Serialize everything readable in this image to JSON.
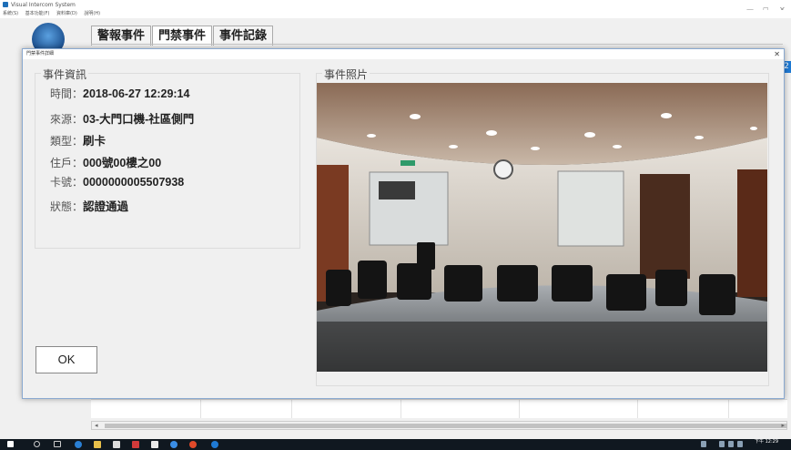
{
  "app": {
    "title": "Visual Intercom System",
    "menu": [
      "系統(S)",
      "基本功能(F)",
      "資料庫(D)",
      "說明(H)"
    ],
    "window_controls": [
      "—",
      "◻",
      "✕"
    ],
    "tabs": [
      {
        "label": "警報事件",
        "active": false
      },
      {
        "label": "門禁事件",
        "active": true
      },
      {
        "label": "事件記錄",
        "active": false
      }
    ],
    "side_badge": "2"
  },
  "dialog": {
    "title": "門禁事件詳細",
    "close_label": "✕",
    "info_group_title": "事件資訊",
    "photo_group_title": "事件照片",
    "fields": [
      {
        "label": "時間：",
        "value": "2018-06-27 12:29:14"
      },
      {
        "label": "來源：",
        "value": "03-大門口機-社區側門"
      },
      {
        "label": "類型：",
        "value": "刷卡"
      },
      {
        "label": "住戶：",
        "value": "000號00樓之00"
      },
      {
        "label": "卡號：",
        "value": "0000000005507938"
      },
      {
        "label": "狀態：",
        "value": "認證通過"
      }
    ],
    "ok_label": "OK"
  },
  "taskbar": {
    "icons": [
      "windows-icon",
      "search-icon",
      "task-view-icon",
      "edge-icon",
      "file-explorer-icon",
      "store-icon",
      "app-icon",
      "mail-icon",
      "ie-icon",
      "chrome-icon",
      "intercom-icon"
    ],
    "clock_time": "下午 12:29"
  },
  "colors": {
    "accent": "#1f7ad4",
    "taskbar": "#101820",
    "dialog_border": "#8aa9d0"
  }
}
